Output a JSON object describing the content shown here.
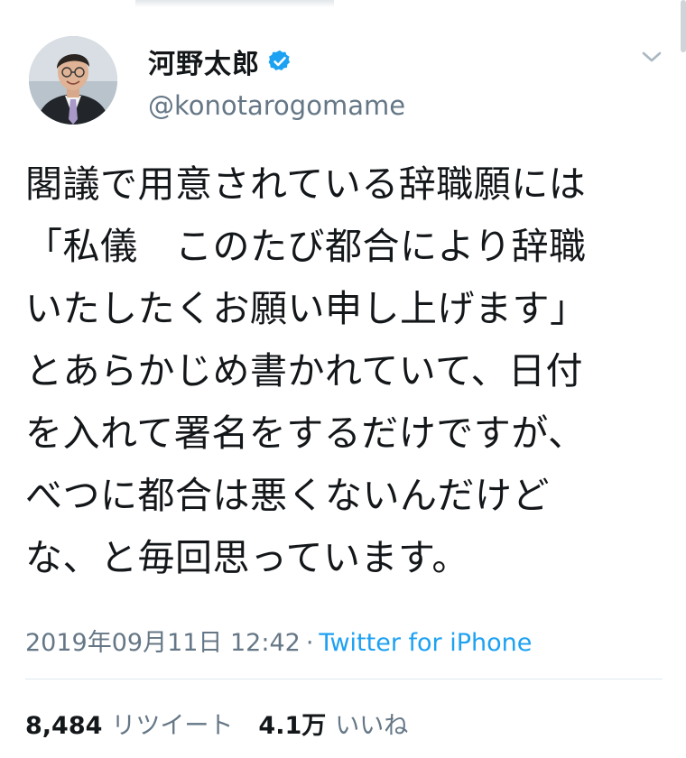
{
  "tweet": {
    "author": {
      "display_name": "河野太郎",
      "handle": "@konotarogomame",
      "verified": true,
      "avatar_icon": "profile-photo"
    },
    "text": "閣議で用意されている辞職願には\n「私儀　このたび都合により辞職\nいたしたくお願い申し上げます」\nとあらかじめ書かれていて、日付\nを入れて署名をするだけですが、\nべつに都合は悪くないんだけど\nな、と毎回思っています。",
    "timestamp": "2019年09月11日 12:42",
    "separator": "·",
    "source": "Twitter for iPhone",
    "retweets": {
      "count": "8,484",
      "label": "リツイート"
    },
    "likes": {
      "count": "4.1万",
      "label": "いいね"
    }
  },
  "colors": {
    "text_primary": "#14171a",
    "text_secondary": "#657786",
    "accent": "#1da1f2",
    "divider": "#e1e8ed"
  },
  "icons": {
    "verified": "verified-badge-icon",
    "menu": "chevron-down-icon"
  }
}
